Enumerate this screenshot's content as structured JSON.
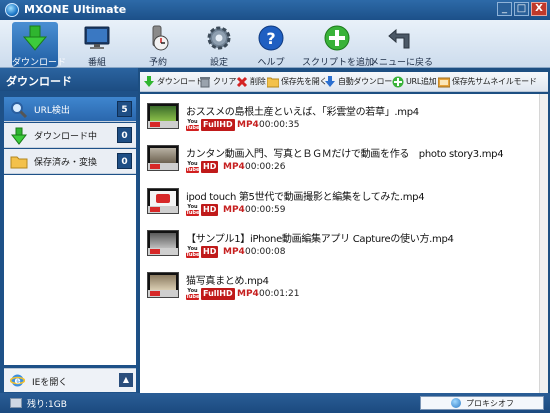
{
  "window": {
    "title": "MXONE Ultimate",
    "controls": {
      "minimize": "_",
      "maximize": "□",
      "close": "X"
    }
  },
  "toolbar": {
    "items": [
      {
        "label": "ダウンロード",
        "icon": "download-arrow-icon",
        "active": true
      },
      {
        "label": "番組",
        "icon": "monitor-icon"
      },
      {
        "label": "予約",
        "icon": "clock-icon"
      },
      {
        "label": "設定",
        "icon": "gear-icon"
      },
      {
        "label": "ヘルプ",
        "icon": "help-icon"
      },
      {
        "label": "スクリプトを追加",
        "icon": "add-icon"
      },
      {
        "label": "メニューに戻る",
        "icon": "back-arrow-icon"
      }
    ]
  },
  "sidebar": {
    "header": "ダウンロード",
    "items": [
      {
        "label": "URL検出",
        "count": "5",
        "icon": "magnifier-icon",
        "selected": true
      },
      {
        "label": "ダウンロード中",
        "count": "0",
        "icon": "download-arrow-icon"
      },
      {
        "label": "保存済み・変換",
        "count": "0",
        "icon": "folder-icon"
      }
    ],
    "ie_label": "IEを開く",
    "ie_toggle": "▲"
  },
  "actions": [
    {
      "label": "ダウンロード",
      "icon": "download-icon"
    },
    {
      "label": "クリア",
      "icon": "trash-icon"
    },
    {
      "label": "削除",
      "icon": "delete-x-icon"
    },
    {
      "label": "保存先を開く",
      "icon": "folder-icon"
    },
    {
      "label": "自動ダウンロード",
      "icon": "auto-download-icon"
    },
    {
      "label": "URL追加",
      "icon": "add-url-icon"
    },
    {
      "label": "保存先サムネイルモード",
      "icon": "thumbnail-mode-icon"
    }
  ],
  "videos": [
    {
      "title": "おススメの島根土産といえば、「彩雲堂の若草」.mp4",
      "source": "YouTube",
      "quality": "FullHD",
      "format": "MP4",
      "duration": "00:00:35"
    },
    {
      "title": "カンタン動画入門、写真とＢＧＭだけで動画を作る　photo story3.mp4",
      "source": "YouTube",
      "quality": "HD",
      "format": "MP4",
      "duration": "00:00:26"
    },
    {
      "title": "ipod touch 第5世代で動画撮影と編集をしてみた.mp4",
      "source": "YouTube",
      "quality": "HD",
      "format": "MP4",
      "duration": "00:00:59"
    },
    {
      "title": "【サンプル1】iPhone動画編集アプリ Captureの使い方.mp4",
      "source": "YouTube",
      "quality": "HD",
      "format": "MP4",
      "duration": "00:00:08"
    },
    {
      "title": "猫写真まとめ.mp4",
      "source": "YouTube",
      "quality": "FullHD",
      "format": "MP4",
      "duration": "00:01:21"
    }
  ],
  "status": {
    "remaining": "残り:1GB",
    "proxy": "プロキシオフ"
  },
  "colors": {
    "accent": "#1d4f82",
    "selected": "#3f86cf",
    "badge_red": "#c01a1a"
  }
}
